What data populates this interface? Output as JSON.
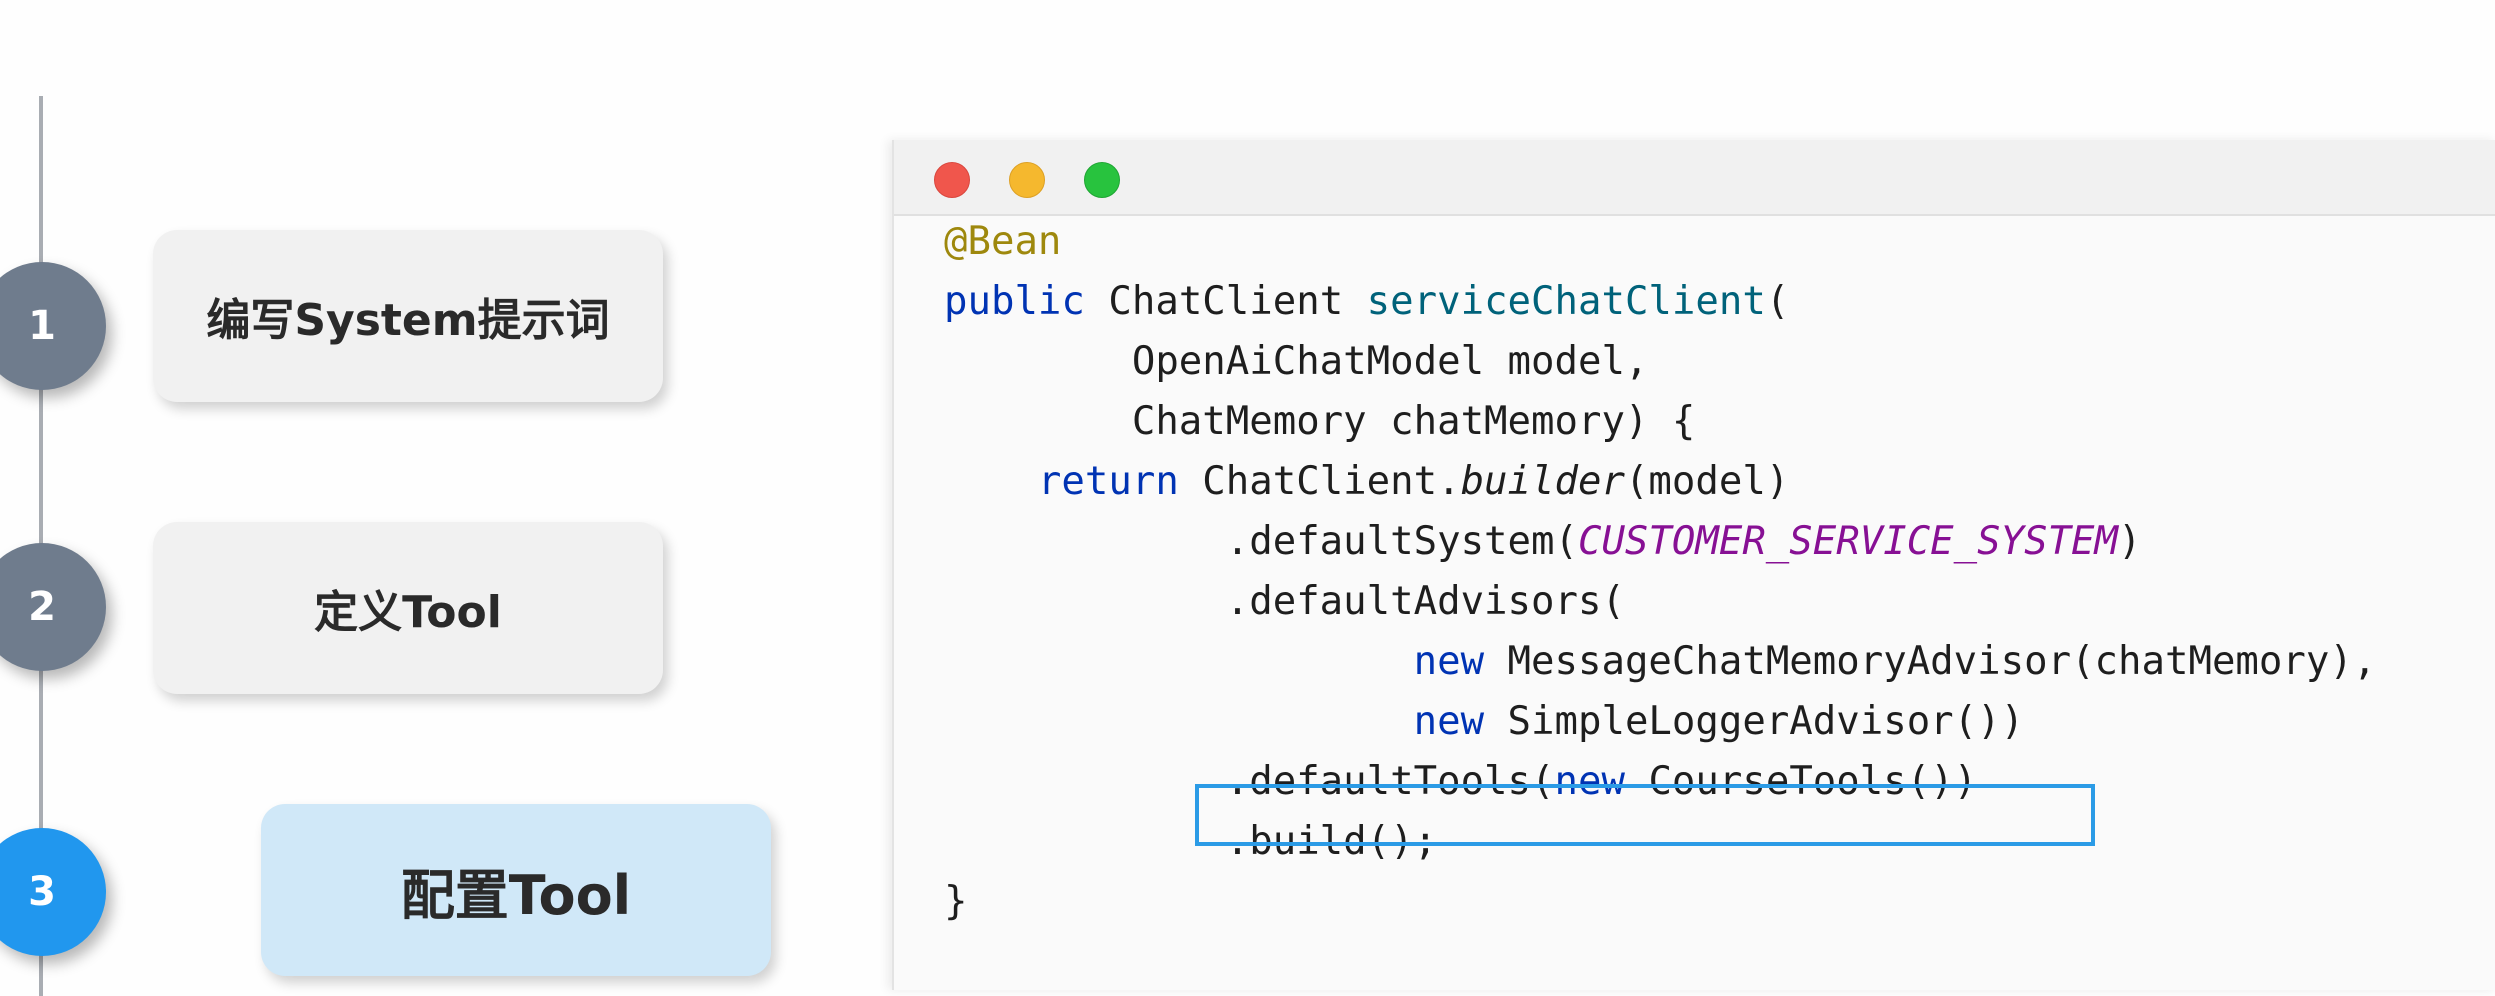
{
  "steps": [
    {
      "number": "1",
      "label": "编写System提示词",
      "state": "done"
    },
    {
      "number": "2",
      "label": "定义Tool",
      "state": "done"
    },
    {
      "number": "3",
      "label": "配置Tool",
      "state": "active"
    }
  ],
  "code": {
    "annotation": "@Bean",
    "kw_public": "public",
    "return_type": "ChatClient",
    "method_name": "serviceChatClient",
    "open_paren": "(",
    "param1": "OpenAiChatModel model,",
    "param2": "ChatMemory chatMemory) {",
    "kw_return": "return",
    "builder_class": "ChatClient.",
    "builder_method": "builder",
    "builder_args": "(model)",
    "default_system_call": ".defaultSystem(",
    "system_constant": "CUSTOMER_SERVICE_SYSTEM",
    "close_paren": ")",
    "default_advisors": ".defaultAdvisors(",
    "kw_new": "new",
    "advisor1": "MessageChatMemoryAdvisor(chatMemory),",
    "advisor2": "SimpleLoggerAdvisor())",
    "default_tools_call": ".defaultTools(",
    "tools_class": "CourseTools())",
    "build_call": ".build();",
    "closing_brace": "}"
  },
  "colors": {
    "step_done": "#6f7c8d",
    "step_active": "#2197ee",
    "card_active": "#d0e8f8",
    "highlight": "#2b9be6"
  }
}
